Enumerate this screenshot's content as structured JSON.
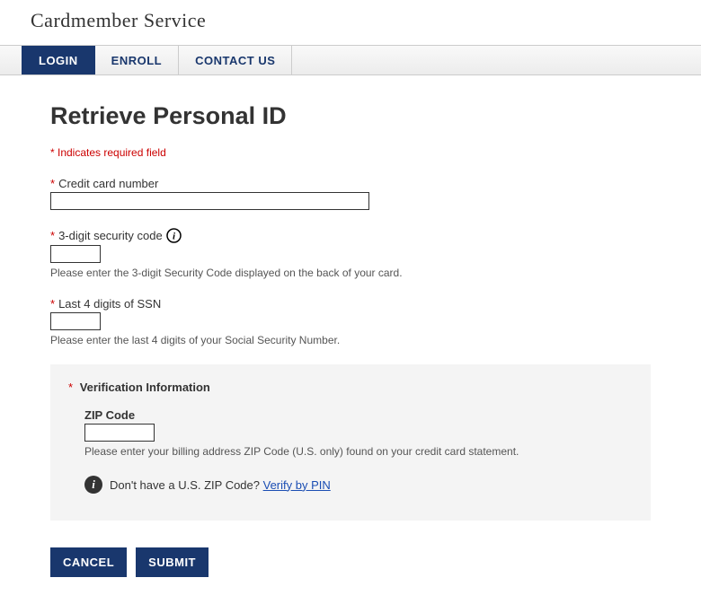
{
  "header": {
    "logo_text": "Cardmember Service"
  },
  "tabs": {
    "login": "LOGIN",
    "enroll": "ENROLL",
    "contact": "CONTACT US"
  },
  "page": {
    "title": "Retrieve Personal ID",
    "required_note": "* Indicates required field"
  },
  "fields": {
    "cc": {
      "label": "Credit card number",
      "value": ""
    },
    "security": {
      "label": "3-digit security code",
      "value": "",
      "helper": "Please enter the 3-digit Security Code displayed on the back of your card."
    },
    "ssn": {
      "label": "Last 4 digits of SSN",
      "value": "",
      "helper": "Please enter the last 4 digits of your Social Security Number."
    }
  },
  "verification": {
    "title": "Verification Information",
    "zip": {
      "label": "ZIP Code",
      "value": "",
      "helper": "Please enter your billing address ZIP Code (U.S. only) found on your credit card statement."
    },
    "no_zip_text": "Don't have a U.S. ZIP Code? ",
    "verify_link": "Verify by PIN"
  },
  "buttons": {
    "cancel": "CANCEL",
    "submit": "SUBMIT"
  }
}
